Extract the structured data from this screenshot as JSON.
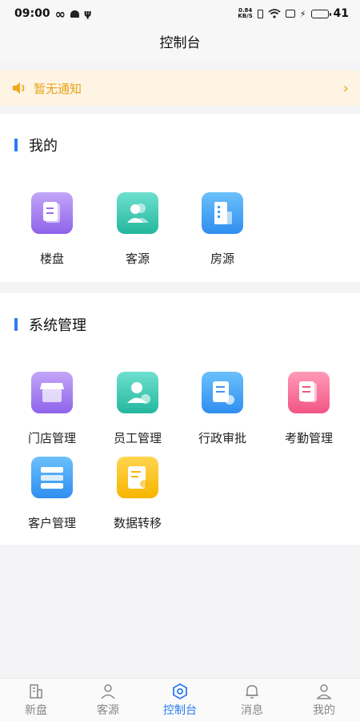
{
  "status": {
    "time": "09:00",
    "net_speed_value": "0.84",
    "net_speed_unit": "KB/S",
    "battery": "41",
    "battery_level": 0.41
  },
  "header": {
    "title": "控制台"
  },
  "notice": {
    "text": "暂无通知",
    "arrow": "›"
  },
  "mine": {
    "title": "我的",
    "items": [
      {
        "label": "楼盘",
        "icon": "building-doc-icon",
        "color": "#9b6df0"
      },
      {
        "label": "客源",
        "icon": "contacts-icon",
        "color": "#2ec4aa"
      },
      {
        "label": "房源",
        "icon": "office-building-icon",
        "color": "#3a98f2"
      }
    ]
  },
  "system": {
    "title": "系统管理",
    "items": [
      {
        "label": "门店管理",
        "icon": "store-icon",
        "color": "#9b6df0"
      },
      {
        "label": "员工管理",
        "icon": "employee-icon",
        "color": "#2ec4aa"
      },
      {
        "label": "行政审批",
        "icon": "approval-icon",
        "color": "#3a98f2"
      },
      {
        "label": "考勤管理",
        "icon": "attendance-icon",
        "color": "#f25585"
      },
      {
        "label": "客户管理",
        "icon": "customer-list-icon",
        "color": "#3a98f2"
      },
      {
        "label": "数据转移",
        "icon": "data-transfer-icon",
        "color": "#f7b500"
      }
    ]
  },
  "tabs": [
    {
      "label": "新盘",
      "icon": "new-building-icon",
      "active": false
    },
    {
      "label": "客源",
      "icon": "person-icon",
      "active": false
    },
    {
      "label": "控制台",
      "icon": "hexagon-console-icon",
      "active": true
    },
    {
      "label": "消息",
      "icon": "bell-icon",
      "active": false
    },
    {
      "label": "我的",
      "icon": "profile-icon",
      "active": false
    }
  ],
  "colors": {
    "accent": "#2b7bf3",
    "notice": "#e8a317",
    "notice_bg": "#fdf4e3"
  }
}
